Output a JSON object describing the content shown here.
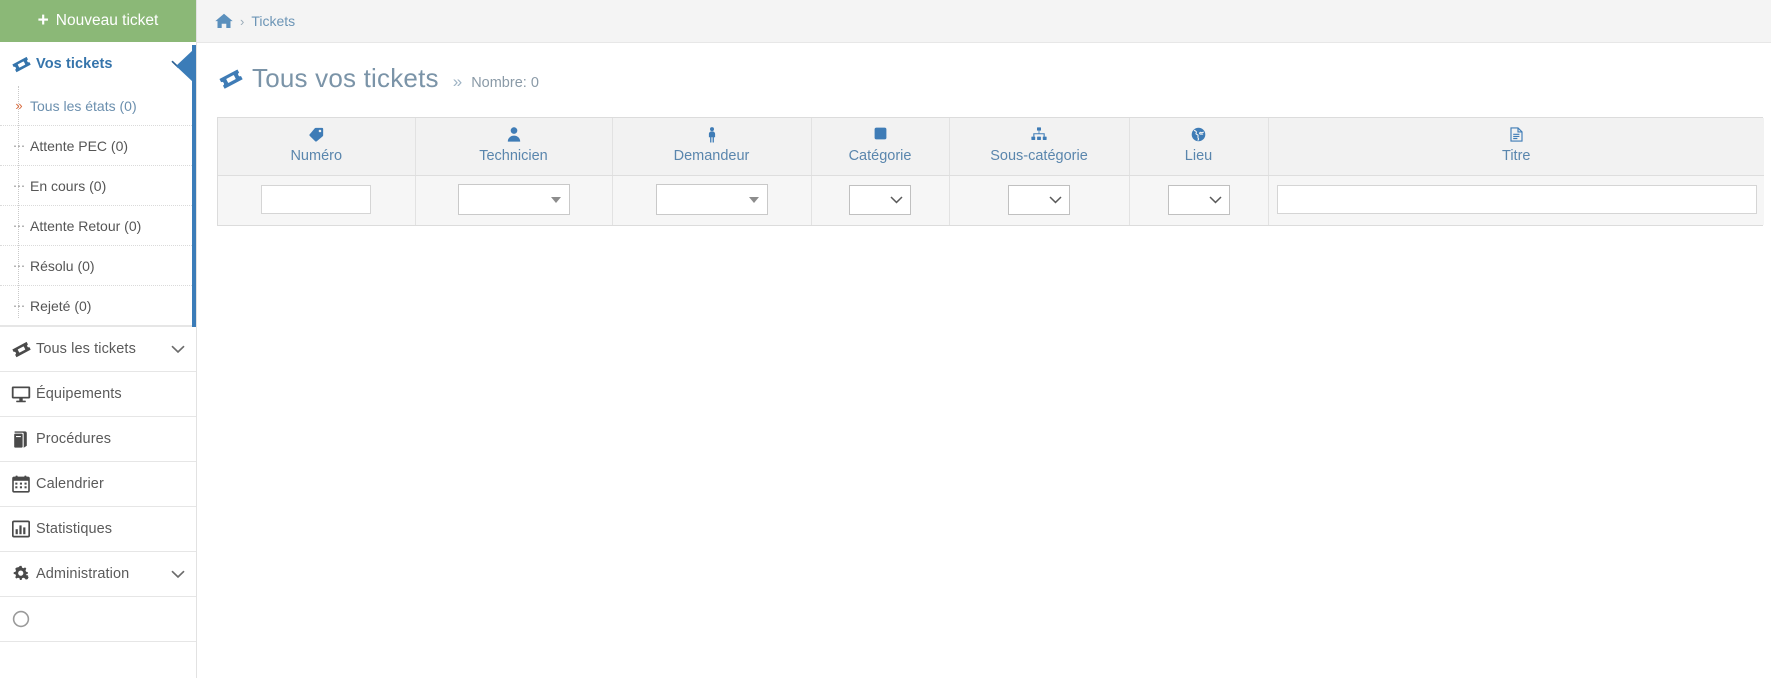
{
  "sidebar": {
    "new_ticket_button": "Nouveau ticket",
    "groups": [
      {
        "label": "Vos tickets",
        "icon": "ticket-icon",
        "active": true,
        "expanded": true,
        "children": [
          {
            "label": "Tous les états (0)",
            "current": true
          },
          {
            "label": "Attente PEC (0)",
            "current": false
          },
          {
            "label": "En cours (0)",
            "current": false
          },
          {
            "label": "Attente Retour (0)",
            "current": false
          },
          {
            "label": "Résolu (0)",
            "current": false
          },
          {
            "label": "Rejeté (0)",
            "current": false
          }
        ]
      },
      {
        "label": "Tous les tickets",
        "icon": "ticket-icon",
        "expandable": true
      },
      {
        "label": "Équipements",
        "icon": "monitor-icon",
        "expandable": false
      },
      {
        "label": "Procédures",
        "icon": "book-icon",
        "expandable": false
      },
      {
        "label": "Calendrier",
        "icon": "calendar-icon",
        "expandable": false
      },
      {
        "label": "Statistiques",
        "icon": "bar-chart-icon",
        "expandable": false
      },
      {
        "label": "Administration",
        "icon": "gears-icon",
        "expandable": true
      }
    ]
  },
  "breadcrumb": {
    "home_icon": "home-icon",
    "separator": "›",
    "items": [
      "Tickets"
    ]
  },
  "page": {
    "icon": "ticket-icon",
    "title": "Tous vos tickets",
    "guillemet": "»",
    "count_label": "Nombre: 0"
  },
  "table": {
    "columns": [
      {
        "key": "numero",
        "label": "Numéro",
        "icon": "tag-icon"
      },
      {
        "key": "technicien",
        "label": "Technicien",
        "icon": "user-icon"
      },
      {
        "key": "demandeur",
        "label": "Demandeur",
        "icon": "person-icon"
      },
      {
        "key": "categorie",
        "label": "Catégorie",
        "icon": "square-icon"
      },
      {
        "key": "sous_categorie",
        "label": "Sous-catégorie",
        "icon": "sitemap-icon"
      },
      {
        "key": "lieu",
        "label": "Lieu",
        "icon": "globe-icon"
      },
      {
        "key": "titre",
        "label": "Titre",
        "icon": "file-icon"
      }
    ],
    "filters": {
      "numero": {
        "type": "text",
        "value": "",
        "placeholder": ""
      },
      "technicien": {
        "type": "select2",
        "value": ""
      },
      "demandeur": {
        "type": "select2",
        "value": ""
      },
      "categorie": {
        "type": "select",
        "value": ""
      },
      "sous_categorie": {
        "type": "select",
        "value": ""
      },
      "lieu": {
        "type": "select",
        "value": ""
      },
      "titre": {
        "type": "text",
        "value": "",
        "placeholder": ""
      }
    },
    "rows": []
  },
  "colors": {
    "accent_blue": "#3b7cb8",
    "green_button": "#8bb877",
    "header_text": "#5a86ad",
    "breadcrumb_bg": "#f4f4f4"
  }
}
